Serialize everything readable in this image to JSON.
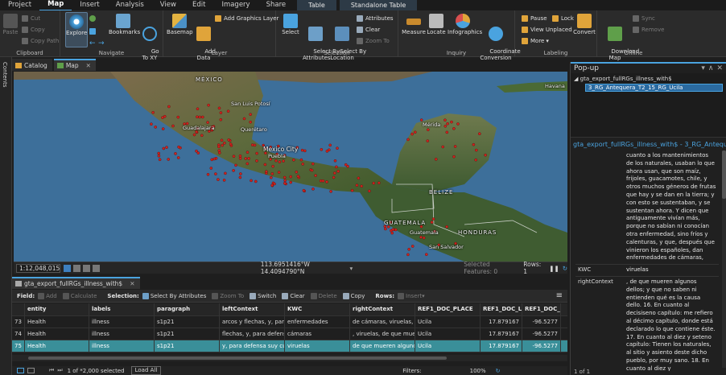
{
  "ribbon_tabs": [
    "Project",
    "Map",
    "Insert",
    "Analysis",
    "View",
    "Edit",
    "Imagery",
    "Share"
  ],
  "ribbon_active_tab": "Map",
  "context_tabs": [
    "Table",
    "Standalone Table"
  ],
  "groups": {
    "clipboard": {
      "label": "Clipboard",
      "paste": "Paste",
      "cut": "Cut",
      "copy": "Copy",
      "copy_path": "Copy Path"
    },
    "navigate": {
      "label": "Navigate",
      "explore": "Explore",
      "bookmarks": "Bookmarks",
      "goto": "Go\nTo XY"
    },
    "layer": {
      "label": "Layer",
      "basemap": "Basemap",
      "add_data": "Add\nData",
      "add_graphics": "Add Graphics Layer"
    },
    "selection": {
      "label": "Selection",
      "select": "Select",
      "by_attr": "Select By\nAttributes",
      "by_loc": "Select By\nLocation",
      "attributes": "Attributes",
      "clear": "Clear",
      "zoom_to": "Zoom To"
    },
    "inquiry": {
      "label": "Inquiry",
      "measure": "Measure",
      "locate": "Locate",
      "infographics": "Infographics",
      "coordinate": "Coordinate\nConversion"
    },
    "labeling": {
      "label": "Labeling",
      "pause": "Pause",
      "lock": "Lock",
      "view_unplaced": "View Unplaced",
      "more": "More",
      "convert": "Convert"
    },
    "offline": {
      "label": "Offline",
      "download": "Download\nMap",
      "sync": "Sync",
      "remove": "Remove"
    }
  },
  "contents_label": "Contents",
  "view_tabs": [
    {
      "label": "Catalog"
    },
    {
      "label": "Map"
    }
  ],
  "map_labels": {
    "mexico": "MÉXICO",
    "san_luis": "San Luis Potosí",
    "guadalajara": "Guadalajara",
    "queretaro": "Querétaro",
    "mexico_city": "Mexico City",
    "puebla": "Puebla",
    "merida": "Mérida",
    "havana": "Havana",
    "belize": "BELIZE",
    "guatemala": "GUATEMALA",
    "guatemala_city": "Guatemala",
    "honduras": "HONDURAS",
    "san_salvador": "San Salvador"
  },
  "map_status": {
    "scale": "1:12,048,015",
    "coordinates": "113.6951416°W 14.4094790°N",
    "selected_features": "Selected Features: 0",
    "rows": "Rows: 1"
  },
  "table_tab": "gta_export_fullRGs_illness_with$",
  "table_toolbar": {
    "field": "Field:",
    "add": "Add",
    "calculate": "Calculate",
    "selection": "Selection:",
    "select_by_attributes": "Select By Attributes",
    "zoom_to": "Zoom To",
    "switch": "Switch",
    "clear": "Clear",
    "delete": "Delete",
    "copy": "Copy",
    "rows": "Rows:",
    "insert": "Insert"
  },
  "table_columns": [
    "entity",
    "labels",
    "paragraph",
    "leftContext",
    "KWC",
    "rightContext",
    "REF1_DOC_PLACE",
    "REF1_DOC_LAT",
    "REF1_DOC_LON"
  ],
  "table_rows": [
    {
      "id": "73",
      "cells": [
        "Health",
        "illness",
        "s1p21",
        "arcos y flechas, y, para...",
        "enfermedades",
        "de cámaras, viruelas, d...",
        "Ucila",
        "17.879167",
        "-96.5277"
      ]
    },
    {
      "id": "74",
      "cells": [
        "Health",
        "illness",
        "s1p21",
        "flechas, y, para defensa...",
        "cámaras",
        ", viruelas, de que muera...",
        "Ucila",
        "17.879167",
        "-96.5277"
      ]
    },
    {
      "id": "75",
      "cells": [
        "Health",
        "illness",
        "s1p21",
        "y, para defensa suy cu...",
        "viruelas",
        "de que mueren algunos...",
        "Ucila",
        "17.879167",
        "-96.5277"
      ]
    }
  ],
  "table_status": {
    "count": "1 of *2,000 selected",
    "load_all": "Load All",
    "filters": "Filters:",
    "zoom": "100%"
  },
  "popup": {
    "title": "Pop-up",
    "layer": "gta_export_fullRGs_illness_with$",
    "feature": "3_RG_Antequera_T2_15_RG_Ucila",
    "header": "gta_export_fullRGs_illness_with$ - 3_RG_Antequ...",
    "context_text": "cuanto a los mantenimientos de los naturales, usaban lo que ahora usan, que son maíz, frijoles, guacamotes, chile, y otros muchos géneros de frutas que hay y se dan en la tierra; y con esto se sustentaban, y se sustentan ahora. Y dicen que antiguamente vivían más, porque no sabían ni conocían otra enfermedad, sino fríos y calenturas, y que, después que vinieron los españoles, dan enfermedades de cámaras,",
    "kwc_label": "KWC",
    "kwc_value": "viruelas",
    "right_label": "rightContext",
    "right_value": ", de que mueren algunos dellos; y que no saben ni entienden qué es la causa dello. 16. En cuanto al decisiseno capítulo: me refiero al décimo capítulo, donde está declarado lo que contiene éste. 17. En cuanto al diez y seteno capítulo: Tienen los naturales, al sitio y asiento deste dicho pueblo, por muy sano. 18. En cuanto al diez y",
    "pager": "1 of 1"
  },
  "colors": {
    "accent": "#4aa3df",
    "selected_row": "#3a8f99",
    "point": "#d1231e",
    "ocean": "#3d6f9a"
  }
}
